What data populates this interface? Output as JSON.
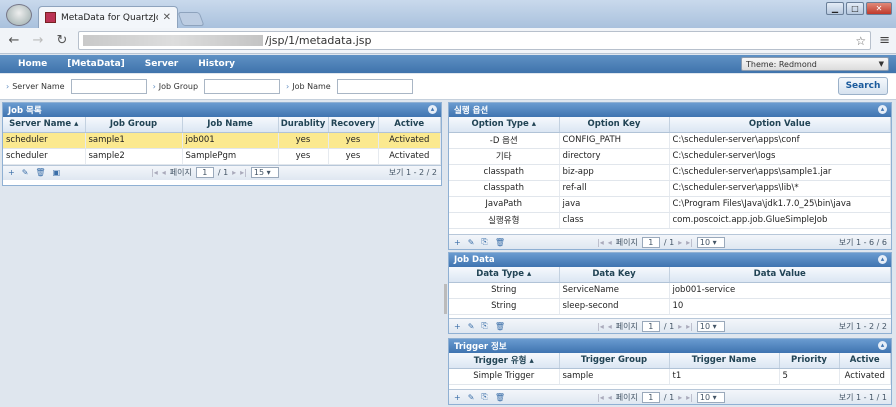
{
  "browser": {
    "tab_title": "MetaData for QuartzJob",
    "url_suffix": "/jsp/1/metadata.jsp"
  },
  "nav": {
    "items": [
      "Home",
      "[MetaData]",
      "Server",
      "History"
    ],
    "theme": "Theme: Redmond"
  },
  "search": {
    "server_label": "Server Name",
    "group_label": "Job Group",
    "job_label": "Job Name",
    "button": "Search"
  },
  "job_list": {
    "title": "Job 목록",
    "columns": [
      "Server Name",
      "Job Group",
      "Job Name",
      "Durablity",
      "Recovery",
      "Active"
    ],
    "rows": [
      [
        "scheduler",
        "sample1",
        "job001",
        "yes",
        "yes",
        "Activated"
      ],
      [
        "scheduler",
        "sample2",
        "SamplePgm",
        "yes",
        "yes",
        "Activated"
      ]
    ],
    "pager": {
      "page_label": "페이지",
      "page": "1",
      "of": "/ 1",
      "size": "15",
      "info": "보기 1 - 2 / 2"
    }
  },
  "options": {
    "title": "실행 옵션",
    "columns": [
      "Option Type",
      "Option Key",
      "Option Value"
    ],
    "rows": [
      [
        "-D 옵션",
        "CONFIG_PATH",
        "C:\\scheduler-server\\apps\\conf"
      ],
      [
        "기타",
        "directory",
        "C:\\scheduler-server\\logs"
      ],
      [
        "classpath",
        "biz-app",
        "C:\\scheduler-server\\apps\\sample1.jar"
      ],
      [
        "classpath",
        "ref-all",
        "C:\\scheduler-server\\apps\\lib\\*"
      ],
      [
        "JavaPath",
        "java",
        "C:\\Program Files\\Java\\jdk1.7.0_25\\bin\\java"
      ],
      [
        "실행유형",
        "class",
        "com.poscoict.app.job.GlueSimpleJob"
      ]
    ],
    "pager": {
      "page_label": "페이지",
      "page": "1",
      "of": "/ 1",
      "size": "10",
      "info": "보기 1 - 6 / 6"
    }
  },
  "jobdata": {
    "title": "Job Data",
    "columns": [
      "Data Type",
      "Data Key",
      "Data Value"
    ],
    "rows": [
      [
        "String",
        "ServiceName",
        "job001-service"
      ],
      [
        "String",
        "sleep-second",
        "10"
      ]
    ],
    "pager": {
      "page_label": "페이지",
      "page": "1",
      "of": "/ 1",
      "size": "10",
      "info": "보기 1 - 2 / 2"
    }
  },
  "trigger": {
    "title": "Trigger 정보",
    "columns": [
      "Trigger 유형",
      "Trigger Group",
      "Trigger Name",
      "Priority",
      "Active"
    ],
    "rows": [
      [
        "Simple Trigger",
        "sample",
        "t1",
        "5",
        "Activated"
      ]
    ],
    "pager": {
      "page_label": "페이지",
      "page": "1",
      "of": "/ 1",
      "size": "10",
      "info": "보기 1 - 1 / 1"
    }
  }
}
